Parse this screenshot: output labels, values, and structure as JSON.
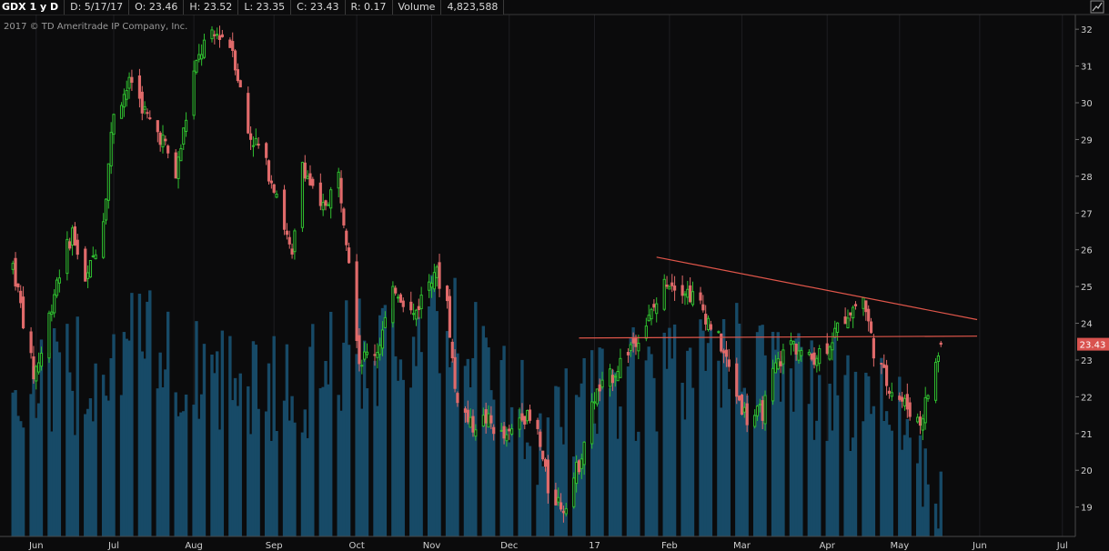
{
  "header": {
    "symbol": "GDX 1 y D",
    "date": "D: 5/17/17",
    "open": "O: 23.46",
    "high": "H: 23.52",
    "low": "L: 23.35",
    "close": "C: 23.43",
    "range": "R: 0.17",
    "volume_label": "Volume",
    "volume_value": "4,823,588"
  },
  "copyright": "2017 © TD Ameritrade IP Company, Inc.",
  "icons": {
    "corner": "trendline-icon"
  },
  "colors": {
    "background": "#0b0b0c",
    "up": "#2fbf2f",
    "down": "#e06a6a",
    "volume": "#174a67",
    "trendline": "#e0564a",
    "price_tag": "#d9534f"
  },
  "chart_data": {
    "type": "candlestick",
    "ylim": [
      18.2,
      32.4
    ],
    "y_ticks": [
      "32",
      "31",
      "30",
      "29",
      "28",
      "27",
      "26",
      "25",
      "24",
      "23",
      "22",
      "21",
      "20",
      "19"
    ],
    "x_ticks": [
      "Jun",
      "Jul",
      "Aug",
      "Sep",
      "Oct",
      "Nov",
      "Dec",
      "17",
      "Feb",
      "Mar",
      "Apr",
      "May",
      "Jun",
      "Jul"
    ],
    "last_price": "23.43",
    "trendlines": [
      {
        "name": "descending-resistance",
        "points": [
          [
            "2017-01-27",
            25.8
          ],
          [
            "2017-05-31",
            24.1
          ]
        ]
      },
      {
        "name": "horizontal-support",
        "points": [
          [
            "2016-12-28",
            23.6
          ],
          [
            "2017-05-31",
            23.65
          ]
        ]
      }
    ],
    "price_path": [
      [
        "2016-05-23",
        25.6
      ],
      [
        "2016-05-31",
        22.6
      ],
      [
        "2016-06-03",
        23.2
      ],
      [
        "2016-06-09",
        25.2
      ],
      [
        "2016-06-15",
        26.5
      ],
      [
        "2016-06-20",
        25.0
      ],
      [
        "2016-06-27",
        26.9
      ],
      [
        "2016-07-01",
        29.8
      ],
      [
        "2016-07-08",
        30.6
      ],
      [
        "2016-07-14",
        29.6
      ],
      [
        "2016-07-20",
        29.0
      ],
      [
        "2016-07-25",
        28.0
      ],
      [
        "2016-08-01",
        30.8
      ],
      [
        "2016-08-05",
        31.6
      ],
      [
        "2016-08-11",
        31.9
      ],
      [
        "2016-08-16",
        31.5
      ],
      [
        "2016-08-22",
        29.2
      ],
      [
        "2016-08-26",
        28.8
      ],
      [
        "2016-09-02",
        27.6
      ],
      [
        "2016-09-08",
        25.7
      ],
      [
        "2016-09-12",
        28.4
      ],
      [
        "2016-09-19",
        27.0
      ],
      [
        "2016-09-26",
        28.0
      ],
      [
        "2016-10-01",
        25.3
      ],
      [
        "2016-10-04",
        23.0
      ],
      [
        "2016-10-11",
        23.3
      ],
      [
        "2016-10-18",
        25.0
      ],
      [
        "2016-10-25",
        24.2
      ],
      [
        "2016-11-02",
        25.5
      ],
      [
        "2016-11-07",
        24.6
      ],
      [
        "2016-11-10",
        22.2
      ],
      [
        "2016-11-16",
        21.2
      ],
      [
        "2016-11-22",
        21.4
      ],
      [
        "2016-11-30",
        20.8
      ],
      [
        "2016-12-06",
        21.6
      ],
      [
        "2016-12-12",
        21.0
      ],
      [
        "2016-12-16",
        19.5
      ],
      [
        "2016-12-22",
        19.0
      ],
      [
        "2016-12-28",
        20.2
      ],
      [
        "2017-01-03",
        22.0
      ],
      [
        "2017-01-10",
        22.6
      ],
      [
        "2017-01-17",
        23.4
      ],
      [
        "2017-01-24",
        24.1
      ],
      [
        "2017-01-31",
        25.2
      ],
      [
        "2017-02-06",
        25.0
      ],
      [
        "2017-02-13",
        24.5
      ],
      [
        "2017-02-21",
        23.4
      ],
      [
        "2017-02-27",
        22.1
      ],
      [
        "2017-03-03",
        21.4
      ],
      [
        "2017-03-09",
        21.6
      ],
      [
        "2017-03-14",
        22.8
      ],
      [
        "2017-03-20",
        23.5
      ],
      [
        "2017-03-27",
        23.0
      ],
      [
        "2017-04-03",
        23.4
      ],
      [
        "2017-04-11",
        24.3
      ],
      [
        "2017-04-17",
        24.7
      ],
      [
        "2017-04-21",
        23.3
      ],
      [
        "2017-04-26",
        22.4
      ],
      [
        "2017-05-03",
        21.8
      ],
      [
        "2017-05-09",
        21.3
      ],
      [
        "2017-05-12",
        22.1
      ],
      [
        "2017-05-17",
        23.43
      ]
    ],
    "volume_path": [
      [
        "2016-05-23",
        0.55
      ],
      [
        "2016-06-15",
        0.6
      ],
      [
        "2016-07-08",
        0.75
      ],
      [
        "2016-08-05",
        0.6
      ],
      [
        "2016-09-08",
        0.55
      ],
      [
        "2016-10-04",
        0.7
      ],
      [
        "2016-11-10",
        0.8
      ],
      [
        "2016-12-16",
        0.35
      ],
      [
        "2017-01-03",
        0.55
      ],
      [
        "2017-02-06",
        0.6
      ],
      [
        "2017-03-03",
        0.7
      ],
      [
        "2017-04-03",
        0.55
      ],
      [
        "2017-05-03",
        0.5
      ],
      [
        "2017-05-17",
        0.05
      ]
    ]
  }
}
